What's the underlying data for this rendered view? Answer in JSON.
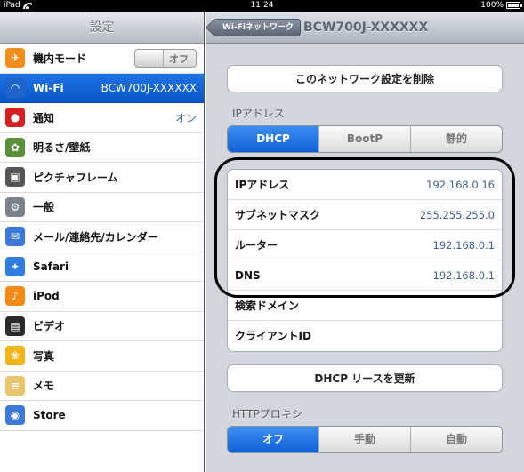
{
  "statusbar": {
    "carrier": "iPad",
    "time": "11:24",
    "battery": "100%"
  },
  "sidebar": {
    "title": "設定",
    "items": [
      {
        "label": "機内モード",
        "icon": "airplane-icon",
        "color": "#f08d1c",
        "toggle": "オフ"
      },
      {
        "label": "Wi-Fi",
        "icon": "wifi-icon",
        "color": "#1e63c8",
        "value": "BCW700J-XXXXXX",
        "active": true
      },
      {
        "label": "通知",
        "icon": "notification-icon",
        "color": "#d42020",
        "value": "オン"
      },
      {
        "label": "明るさ/壁紙",
        "icon": "brightness-icon",
        "color": "#5a8f3b"
      },
      {
        "label": "ピクチャフレーム",
        "icon": "picture-frame-icon",
        "color": "#555555"
      },
      {
        "label": "一般",
        "icon": "gear-icon",
        "color": "#7b818a"
      },
      {
        "label": "メール/連絡先/カレンダー",
        "icon": "mail-icon",
        "color": "#3b78d8"
      },
      {
        "label": "Safari",
        "icon": "compass-icon",
        "color": "#2f7ee0"
      },
      {
        "label": "iPod",
        "icon": "music-icon",
        "color": "#f28a17"
      },
      {
        "label": "ビデオ",
        "icon": "film-icon",
        "color": "#2a2a2a"
      },
      {
        "label": "写真",
        "icon": "flower-icon",
        "color": "#f2b51b"
      },
      {
        "label": "メモ",
        "icon": "note-icon",
        "color": "#e9c66e"
      },
      {
        "label": "Store",
        "icon": "store-icon",
        "color": "#3d7ad8"
      }
    ]
  },
  "detail": {
    "back_label": "Wi-Fiネットワーク",
    "title": "BCW700J-XXXXXX",
    "forget_label": "このネットワーク設定を削除",
    "ip_section_label": "IPアドレス",
    "ip_modes": [
      "DHCP",
      "BootP",
      "静的"
    ],
    "ip_mode_selected": 0,
    "rows": [
      {
        "label": "IPアドレス",
        "value": "192.168.0.16"
      },
      {
        "label": "サブネットマスク",
        "value": "255.255.255.0"
      },
      {
        "label": "ルーター",
        "value": "192.168.0.1"
      },
      {
        "label": "DNS",
        "value": "192.168.0.1"
      },
      {
        "label": "検索ドメイン",
        "value": ""
      },
      {
        "label": "クライアントID",
        "value": ""
      }
    ],
    "renew_label": "DHCP リースを更新",
    "proxy_section_label": "HTTPプロキシ",
    "proxy_modes": [
      "オフ",
      "手動",
      "自動"
    ],
    "proxy_mode_selected": 0
  },
  "colors": {
    "accent": "#1061d8",
    "value_text": "#3f5d8c"
  }
}
